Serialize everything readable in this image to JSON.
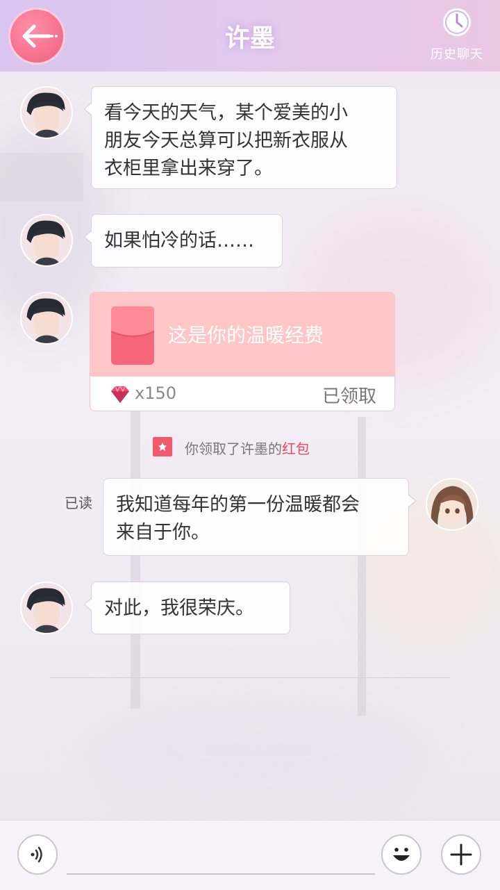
{
  "header": {
    "title": "许墨",
    "back_icon": "back-arrow-icon",
    "history_icon": "clock-icon",
    "history_label": "历史聊天"
  },
  "messages": [
    {
      "sender": "contact",
      "text_lines": [
        "看今天的天气，某个爱美的小",
        "朋友今天总算可以把新衣服从",
        "衣柜里拿出来穿了。"
      ]
    },
    {
      "sender": "contact",
      "text": "如果怕冷的话……"
    },
    {
      "sender": "contact",
      "type": "red_packet",
      "text": "这是你的温暖经费",
      "gem_icon": "diamond-gem-icon",
      "amount": "x150",
      "status": "已领取"
    },
    {
      "sender": "self",
      "read_label": "已读",
      "text_lines": [
        "我知道每年的第一份温暖都会",
        "来自于你。"
      ]
    },
    {
      "sender": "contact",
      "text": "对此，我很荣庆。"
    }
  ],
  "system_notice": {
    "prefix": "你领取了许墨的",
    "highlight": "红包",
    "icon": "red-packet-icon"
  },
  "input_bar": {
    "voice_icon": "voice-icon",
    "emoji_icon": "emoji-icon",
    "plus_icon": "plus-icon",
    "value": ""
  },
  "colors": {
    "accent_pink": "#f0607f",
    "red_packet": "#ffc6c8",
    "highlight_red": "#e74a5e",
    "header_purple": "#d8c4ef"
  }
}
